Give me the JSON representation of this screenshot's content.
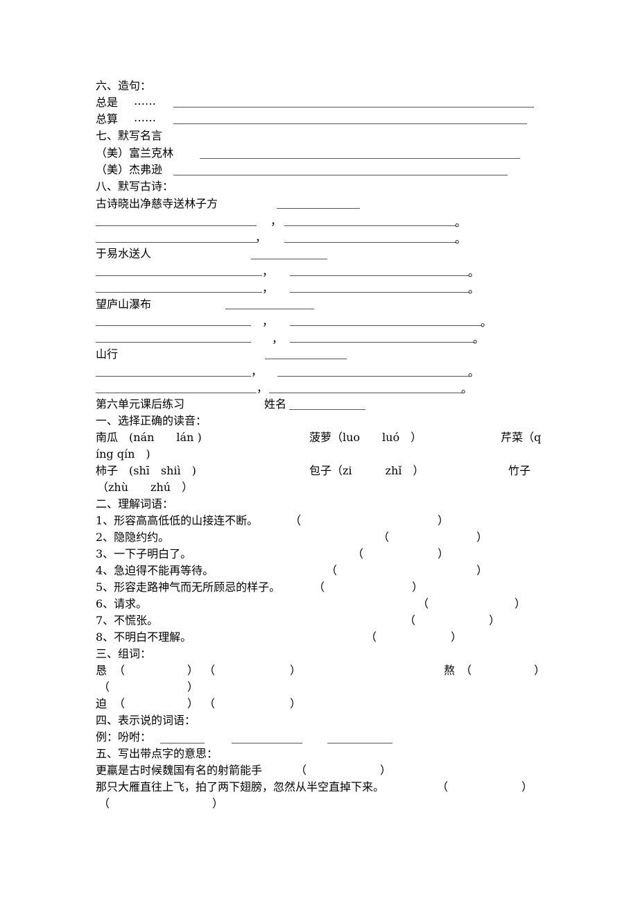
{
  "sec6": {
    "heading": "六、造句：",
    "items": [
      {
        "word": "总是",
        "dots": "……"
      },
      {
        "word": "总算",
        "dots": "……"
      }
    ]
  },
  "sec7": {
    "heading": "七、默写名言",
    "items": [
      "（美）富兰克林",
      "（美）杰弗逊"
    ]
  },
  "sec8": {
    "heading": "八、默写古诗：",
    "poems": [
      {
        "title": "古诗晓出净慈寺送林子方"
      },
      {
        "title": "于易水送人"
      },
      {
        "title": "望庐山瀑布"
      },
      {
        "title": "山行"
      }
    ],
    "comma": "，",
    "period": "。"
  },
  "unit6": {
    "title": "第六单元课后练习",
    "name_label": "姓名"
  },
  "q1": {
    "heading": "一、选择正确的读音：",
    "row1": [
      "南瓜　(nán　　lán )",
      "菠萝（luo　　luó　）",
      "芹菜（q"
    ],
    "row1b": "íng qín　)",
    "row2": [
      "柿子　(shī　shiì　)",
      "包子（zi　　　zhǐ　）",
      "竹子"
    ],
    "row2b": "（zhù　　zhú　）"
  },
  "q2": {
    "heading": "二、理解词语：",
    "items": [
      "1、形容高高低低的山接连不断。",
      "2、隐隐约约。",
      "3、一下子明白了。",
      "4、急迫得不能再等待。",
      "5、形容走路神气而无所顾忌的样子。",
      "6、请求。",
      "7、不慌张。",
      "8、不明白不理解。"
    ],
    "open": "（",
    "close": "）"
  },
  "q3": {
    "heading": "三、组词：",
    "chars": [
      "恳",
      "熬",
      "迫"
    ],
    "open": "（",
    "close": "）"
  },
  "q4": {
    "heading": "四、表示说的词语：",
    "example": "例：吩咐："
  },
  "q5": {
    "heading": "五、写出带点字的意思：",
    "items": [
      "更羸是古时候魏国有名的射箭能手",
      "那只大雁直往上飞，拍了两下翅膀，忽然从半空直掉下来。"
    ],
    "open": "（",
    "close": "）"
  }
}
